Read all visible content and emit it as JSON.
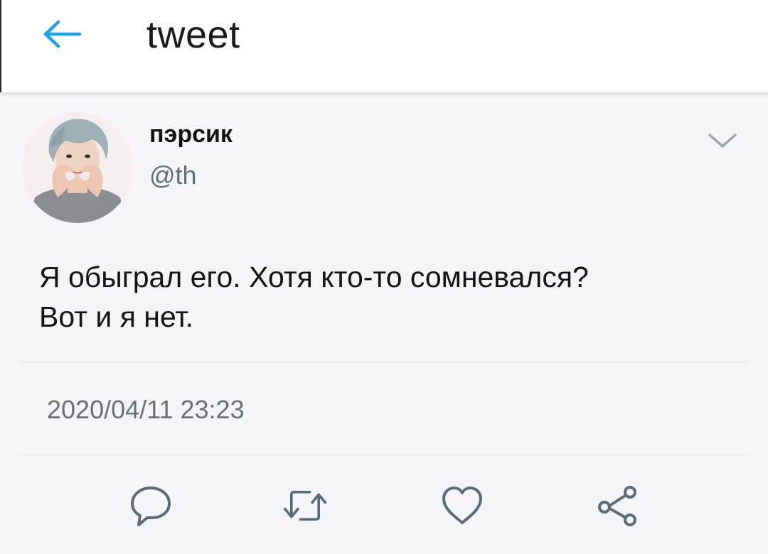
{
  "header": {
    "title": "tweet",
    "back_icon": "arrow-left-icon"
  },
  "colors": {
    "accent": "#1da1f2",
    "text_primary": "#141414",
    "text_secondary": "#5f6e7c",
    "icon_gray": "#5b6b7a",
    "background": "#f5f5f7"
  },
  "tweet": {
    "author_name": "пэрсик",
    "author_handle": "@th",
    "text": "Я обыграл его. Хотя кто-то сомневался?\nВот и я нет.",
    "timestamp": "2020/04/11 23:23",
    "menu_icon": "chevron-down-icon"
  },
  "actions": [
    {
      "icon": "reply-icon"
    },
    {
      "icon": "retweet-icon"
    },
    {
      "icon": "like-icon"
    },
    {
      "icon": "share-icon"
    }
  ]
}
